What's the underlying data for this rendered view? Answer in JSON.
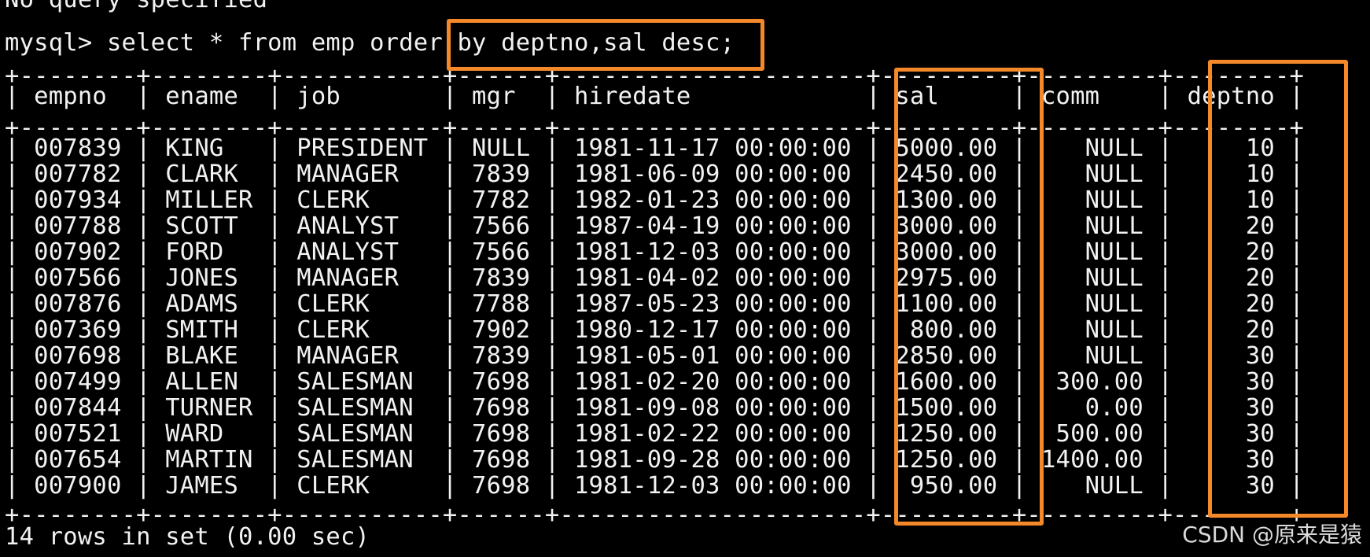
{
  "terminal": {
    "cut_line": "No query specified",
    "prompt": "mysql> select * from emp order by deptno,sal desc;",
    "separator_top": "+--------+--------+-----------+------+---------------------+---------+---------+--------+",
    "header": "| empno  | ename  | job       | mgr  | hiredate            | sal     | comm    | deptno |",
    "separator_mid": "+--------+--------+-----------+------+---------------------+---------+---------+--------+",
    "rows": [
      "| 007839 | KING   | PRESIDENT | NULL | 1981-11-17 00:00:00 | 5000.00 |    NULL |     10 |",
      "| 007782 | CLARK  | MANAGER   | 7839 | 1981-06-09 00:00:00 | 2450.00 |    NULL |     10 |",
      "| 007934 | MILLER | CLERK     | 7782 | 1982-01-23 00:00:00 | 1300.00 |    NULL |     10 |",
      "| 007788 | SCOTT  | ANALYST   | 7566 | 1987-04-19 00:00:00 | 3000.00 |    NULL |     20 |",
      "| 007902 | FORD   | ANALYST   | 7566 | 1981-12-03 00:00:00 | 3000.00 |    NULL |     20 |",
      "| 007566 | JONES  | MANAGER   | 7839 | 1981-04-02 00:00:00 | 2975.00 |    NULL |     20 |",
      "| 007876 | ADAMS  | CLERK     | 7788 | 1987-05-23 00:00:00 | 1100.00 |    NULL |     20 |",
      "| 007369 | SMITH  | CLERK     | 7902 | 1980-12-17 00:00:00 |  800.00 |    NULL |     20 |",
      "| 007698 | BLAKE  | MANAGER   | 7839 | 1981-05-01 00:00:00 | 2850.00 |    NULL |     30 |",
      "| 007499 | ALLEN  | SALESMAN  | 7698 | 1981-02-20 00:00:00 | 1600.00 |  300.00 |     30 |",
      "| 007844 | TURNER | SALESMAN  | 7698 | 1981-09-08 00:00:00 | 1500.00 |    0.00 |     30 |",
      "| 007521 | WARD   | SALESMAN  | 7698 | 1981-02-22 00:00:00 | 1250.00 |  500.00 |     30 |",
      "| 007654 | MARTIN | SALESMAN  | 7698 | 1981-09-28 00:00:00 | 1250.00 | 1400.00 |     30 |",
      "| 007900 | JAMES  | CLERK     | 7698 | 1981-12-03 00:00:00 |  950.00 |    NULL |     30 |"
    ],
    "separator_bottom": "+--------+--------+-----------+------+---------------------+---------+---------+--------+",
    "footer": "14 rows in set (0.00 sec)"
  },
  "watermark": "CSDN @原来是猿",
  "colors": {
    "background": "#000000",
    "text": "#f2f2f2",
    "highlight": "#f5892a"
  }
}
